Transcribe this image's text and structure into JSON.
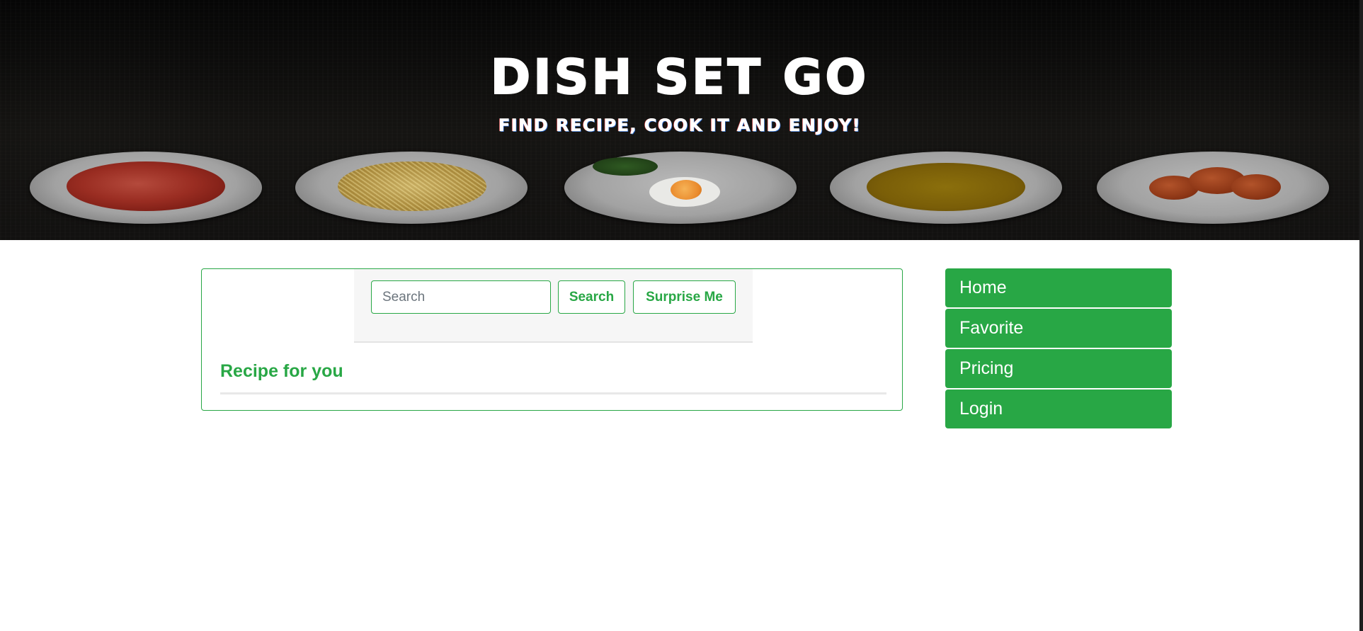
{
  "hero": {
    "title": "DISH SET GO",
    "subtitle": "FIND RECIPE, COOK IT AND ENJOY!"
  },
  "search": {
    "placeholder": "Search",
    "value": "",
    "search_button_label": "Search",
    "surprise_button_label": "Surprise Me"
  },
  "main": {
    "section_title": "Recipe for you"
  },
  "sidebar": {
    "items": [
      {
        "label": "Home"
      },
      {
        "label": "Favorite"
      },
      {
        "label": "Pricing"
      },
      {
        "label": "Login"
      }
    ]
  },
  "colors": {
    "accent": "#28a745",
    "hero_background": "#121110",
    "card_background": "#f6f6f6"
  }
}
